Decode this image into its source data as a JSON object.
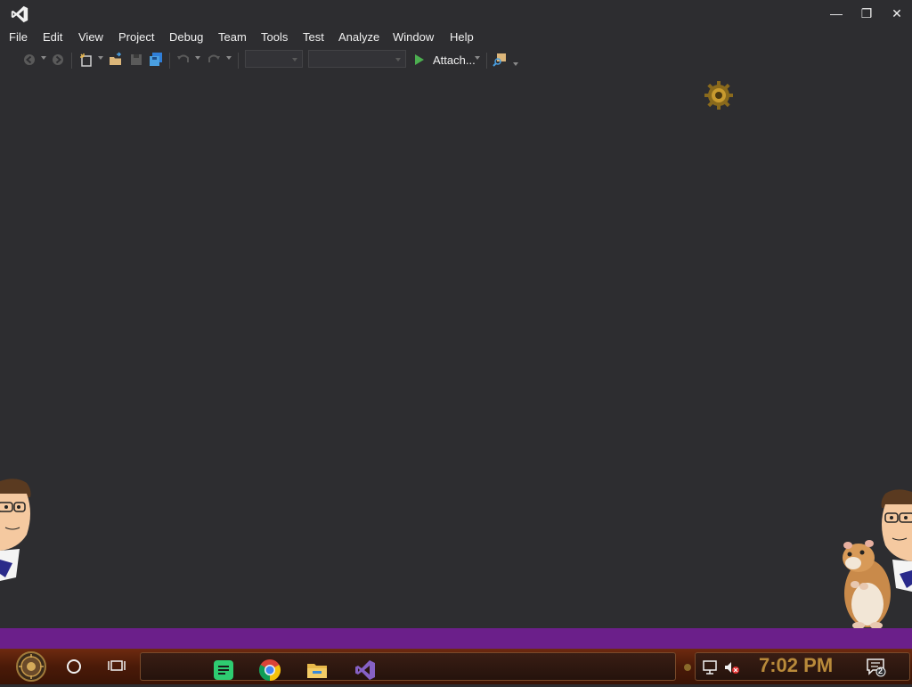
{
  "app": {
    "title_icon": "visual-studio-logo-icon"
  },
  "window_controls": {
    "minimize": "—",
    "restore": "❐",
    "close": "✕"
  },
  "menu": [
    "File",
    "Edit",
    "View",
    "Project",
    "Debug",
    "Team",
    "Tools",
    "Test",
    "Analyze",
    "Window",
    "Help"
  ],
  "toolbar": {
    "attach_label": "Attach...",
    "icons": [
      "back-icon",
      "forward-icon",
      "new-project-icon",
      "open-file-icon",
      "save-icon",
      "save-all-icon",
      "undo-icon",
      "redo-icon",
      "find-in-files-icon"
    ],
    "config_combo_value": "",
    "platform_combo_value": ""
  },
  "taskbar": {
    "clock": "7:02 PM",
    "notification_count": "2",
    "apps": [
      "spotify-lite-icon",
      "chrome-icon",
      "file-explorer-icon",
      "visual-studio-icon"
    ]
  },
  "colors": {
    "accent": "#68217a",
    "taskbar": "#4a1a08",
    "clock": "#b98a3a",
    "background": "#2d2d30"
  }
}
